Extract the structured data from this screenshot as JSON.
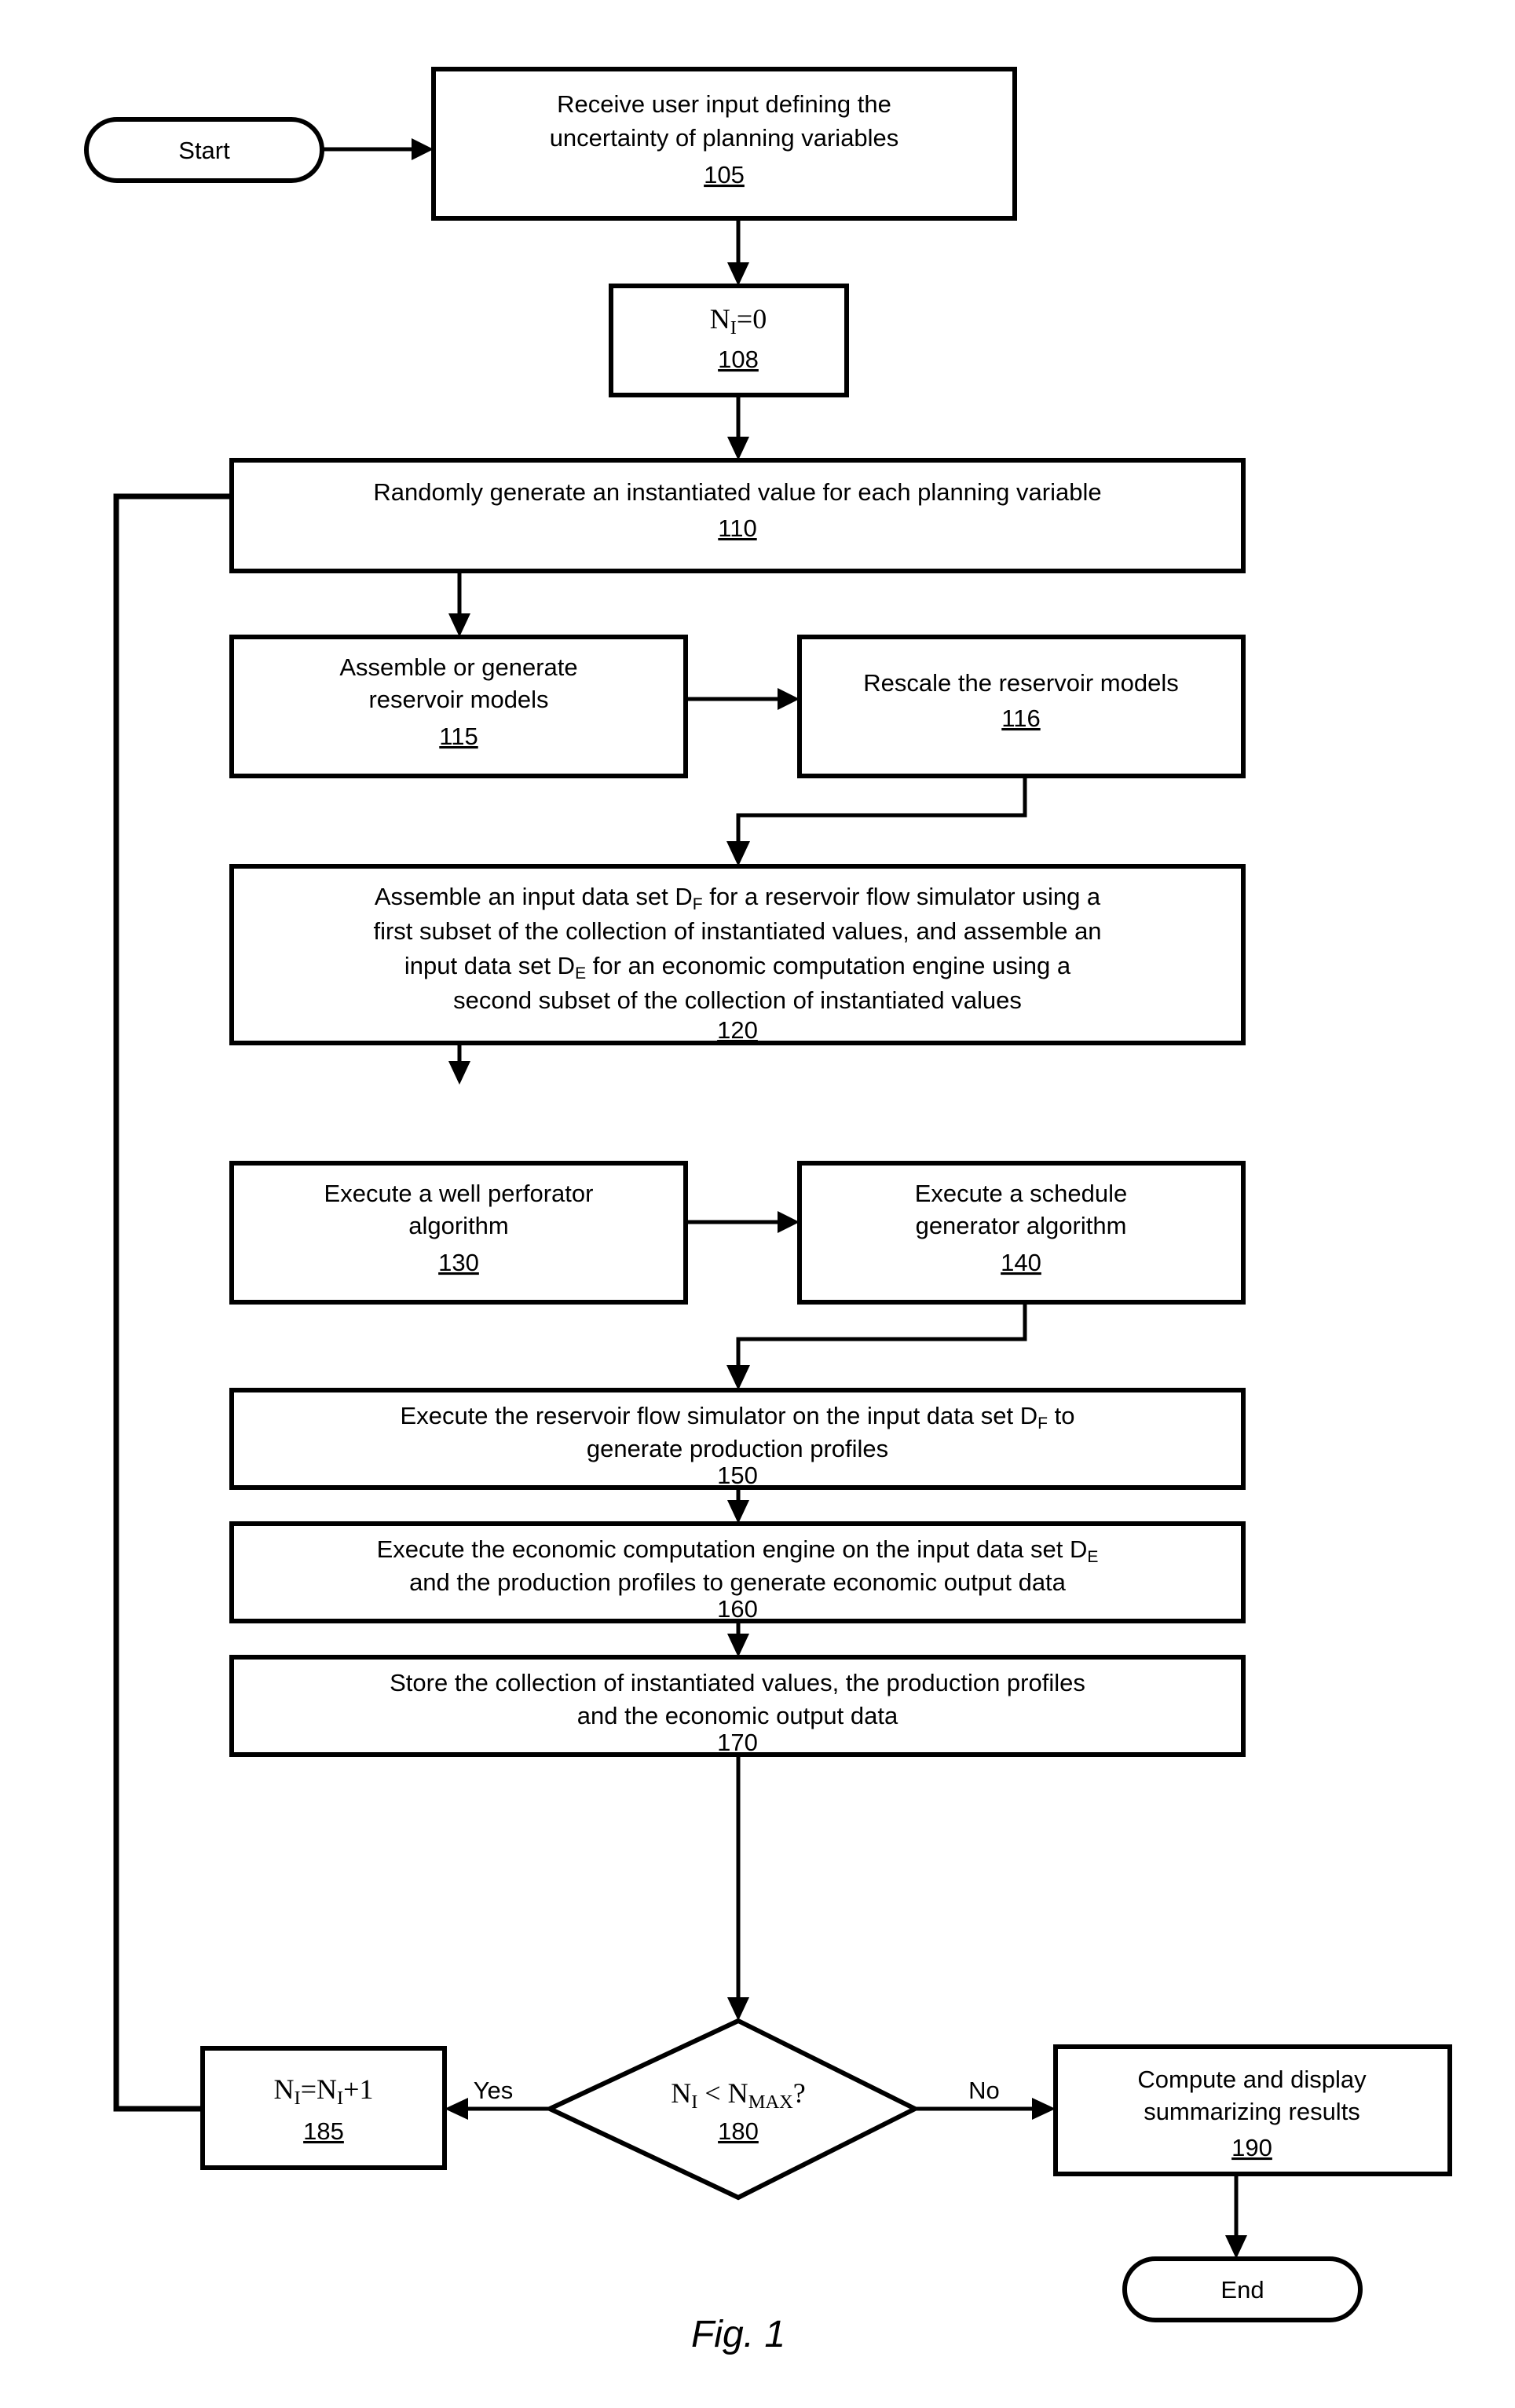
{
  "figure": {
    "caption": "Fig. 1",
    "title": "Flowchart of reservoir planning uncertainty simulation method"
  },
  "nodes": {
    "start": {
      "label": "Start",
      "shape": "terminator"
    },
    "n105": {
      "lines": [
        "Receive user input defining the",
        "uncertainty of planning variables"
      ],
      "ref": "105",
      "shape": "process"
    },
    "n108": {
      "expr_main": "N",
      "expr_sub": "I",
      "expr_rest": "=0",
      "lines": [
        "N_I=0"
      ],
      "ref": "108",
      "shape": "process"
    },
    "n110": {
      "lines": [
        "Randomly generate an instantiated value for each planning variable"
      ],
      "ref": "110",
      "shape": "process"
    },
    "n115": {
      "lines": [
        "Assemble or generate",
        "reservoir models"
      ],
      "ref": "115",
      "shape": "process"
    },
    "n116": {
      "lines": [
        "Rescale the reservoir models"
      ],
      "ref": "116",
      "shape": "process"
    },
    "n120": {
      "line1_a": "Assemble an input data set D",
      "line1_sub": "F",
      "line1_b": " for a reservoir flow simulator using a",
      "line2": "first subset of the collection of instantiated values, and assemble an",
      "line3_a": "input data set D",
      "line3_sub": "E",
      "line3_b": " for an economic computation engine using a",
      "line4": "second subset of the collection of instantiated values",
      "ref": "120",
      "shape": "process"
    },
    "n130": {
      "lines": [
        "Execute a well perforator",
        "algorithm"
      ],
      "ref": "130",
      "shape": "process"
    },
    "n140": {
      "lines": [
        "Execute a schedule",
        "generator algorithm"
      ],
      "ref": "140",
      "shape": "process"
    },
    "n150": {
      "line1_a": "Execute the reservoir flow simulator on the input data set D",
      "line1_sub": "F",
      "line1_b": " to",
      "line2": "generate production profiles",
      "ref": "150",
      "shape": "process"
    },
    "n160": {
      "line1_a": "Execute the economic computation engine on the input data set D",
      "line1_sub": "E",
      "line1_b": "",
      "line2": "and the production profiles to generate economic output data",
      "ref": "160",
      "shape": "process"
    },
    "n170": {
      "lines": [
        "Store the collection of instantiated values, the production profiles",
        "and the economic output data"
      ],
      "ref": "170",
      "shape": "process"
    },
    "n180": {
      "expr_a": "N",
      "expr_a_sub": "I",
      "expr_mid": " < N",
      "expr_b_sub": "MAX",
      "expr_end": "?",
      "ref": "180",
      "shape": "decision"
    },
    "n185": {
      "expr_a": "N",
      "expr_a_sub": "I",
      "expr_eq": "=N",
      "expr_b_sub": "I",
      "expr_end": "+1",
      "ref": "185",
      "shape": "process"
    },
    "n190": {
      "lines": [
        "Compute and display",
        "summarizing results"
      ],
      "ref": "190",
      "shape": "process"
    },
    "end": {
      "label": "End",
      "shape": "terminator"
    }
  },
  "edges": {
    "yes_label": "Yes",
    "no_label": "No"
  },
  "colors": {
    "stroke": "#000000",
    "fill": "#ffffff",
    "text": "#000000"
  }
}
